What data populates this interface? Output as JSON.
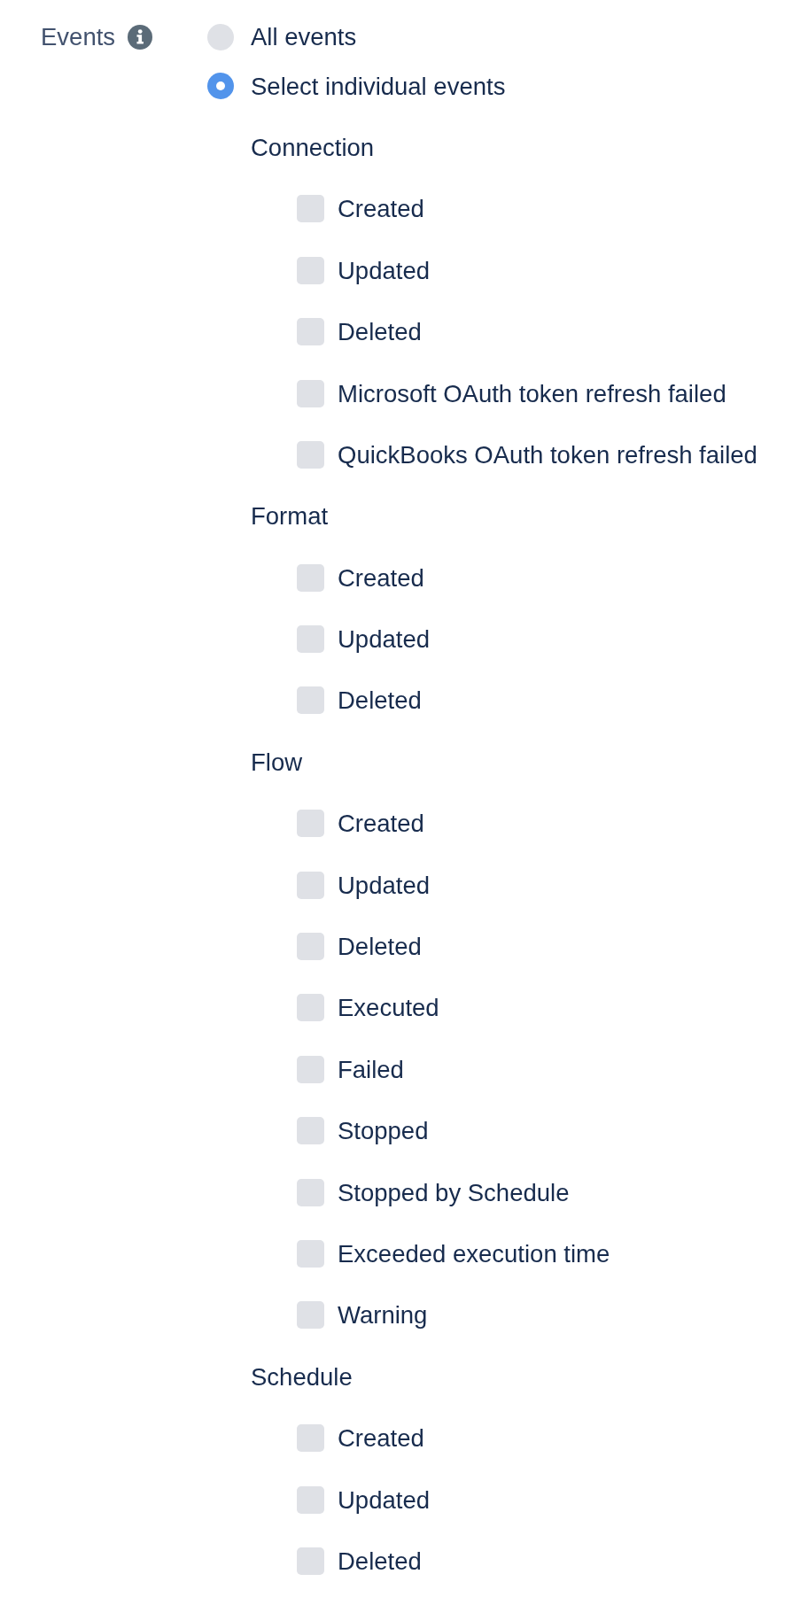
{
  "field": {
    "label": "Events"
  },
  "options": [
    {
      "label": "All events",
      "selected": false
    },
    {
      "label": "Select individual events",
      "selected": true
    }
  ],
  "groups": [
    {
      "title": "Connection",
      "events": [
        {
          "label": "Created",
          "checked": false
        },
        {
          "label": "Updated",
          "checked": false
        },
        {
          "label": "Deleted",
          "checked": false
        },
        {
          "label": "Microsoft OAuth token refresh failed",
          "checked": false
        },
        {
          "label": "QuickBooks OAuth token refresh failed",
          "checked": false
        }
      ]
    },
    {
      "title": "Format",
      "events": [
        {
          "label": "Created",
          "checked": false
        },
        {
          "label": "Updated",
          "checked": false
        },
        {
          "label": "Deleted",
          "checked": false
        }
      ]
    },
    {
      "title": "Flow",
      "events": [
        {
          "label": "Created",
          "checked": false
        },
        {
          "label": "Updated",
          "checked": false
        },
        {
          "label": "Deleted",
          "checked": false
        },
        {
          "label": "Executed",
          "checked": false
        },
        {
          "label": "Failed",
          "checked": false
        },
        {
          "label": "Stopped",
          "checked": false
        },
        {
          "label": "Stopped by Schedule",
          "checked": false
        },
        {
          "label": "Exceeded execution time",
          "checked": false
        },
        {
          "label": "Warning",
          "checked": false
        }
      ]
    },
    {
      "title": "Schedule",
      "events": [
        {
          "label": "Created",
          "checked": false
        },
        {
          "label": "Updated",
          "checked": false
        },
        {
          "label": "Deleted",
          "checked": false
        }
      ]
    }
  ]
}
